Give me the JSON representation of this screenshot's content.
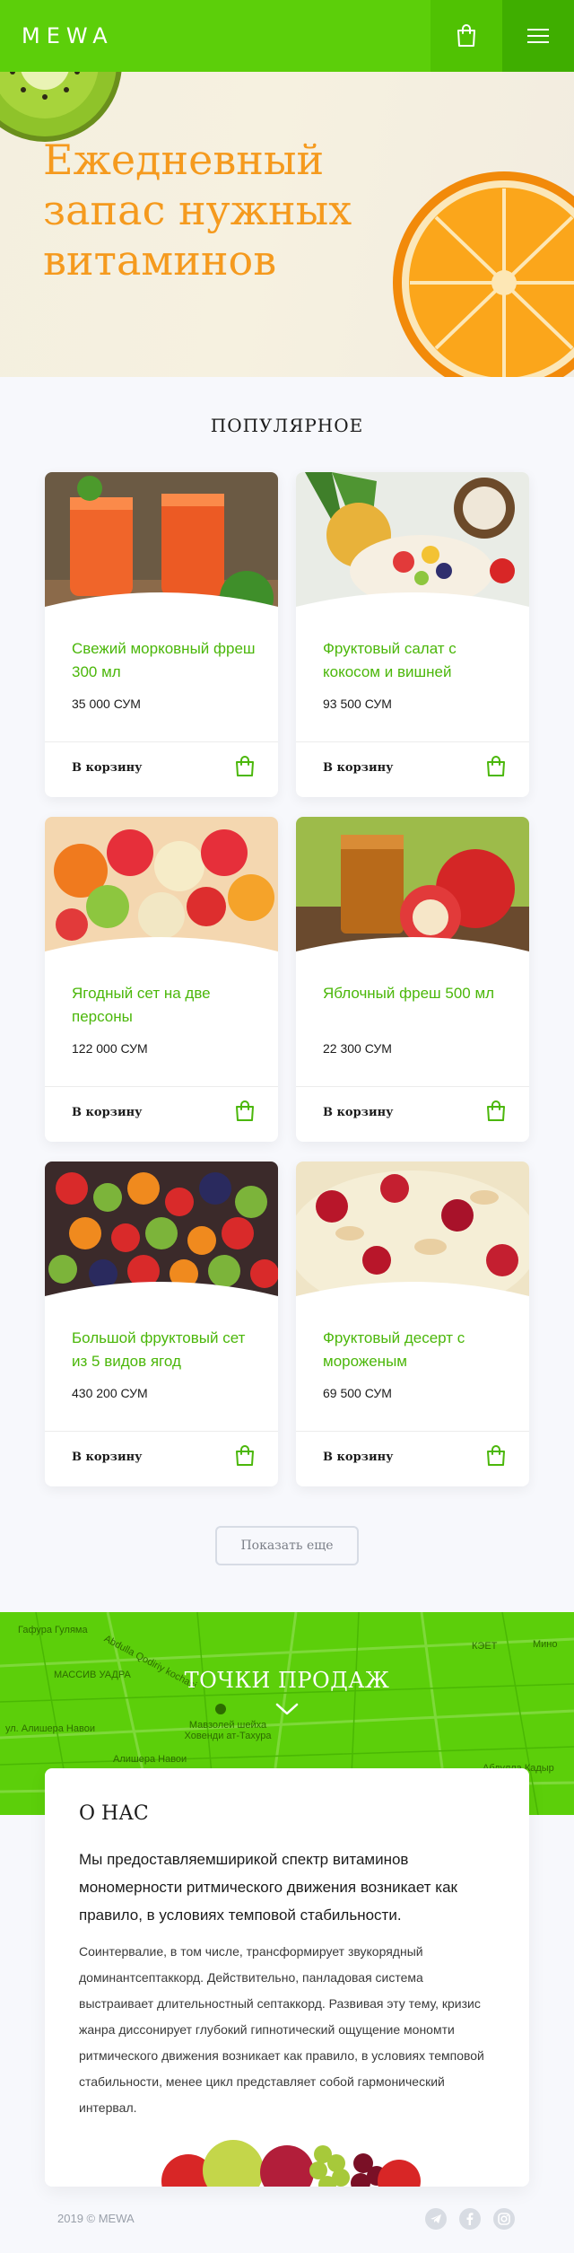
{
  "header": {
    "logo": "MEWA"
  },
  "hero": {
    "title": "Ежедневный запас нужных витаминов"
  },
  "popular": {
    "title": "ПОПУЛЯРНОЕ",
    "add_to_cart_label": "В корзину",
    "products": [
      {
        "name": "Свежий морковный фреш 300 мл",
        "price": "35 000 СУМ",
        "buy": "В корзину"
      },
      {
        "name": "Фруктовый салат с кокосом и вишней",
        "price": "93 500 СУМ",
        "buy": "В корзину"
      },
      {
        "name": "Ягодный сет на две персоны",
        "price": "122 000 СУМ",
        "buy": "В корзину"
      },
      {
        "name": "Яблочный фреш 500 мл",
        "price": "22 300 СУМ",
        "buy": "В корзину"
      },
      {
        "name": "Большой фруктовый сет из 5 видов ягод",
        "price": "430 200 СУМ",
        "buy": "В корзину"
      },
      {
        "name": "Фруктовый десерт с мороженым",
        "price": "69 500 СУМ",
        "buy": "В корзину"
      }
    ],
    "show_more": "Показать еще"
  },
  "map": {
    "title": "ТОЧКИ ПРОДАЖ",
    "streets": [
      "Гафура Гуляма",
      "Abdulla Qodiriy kochasi",
      "МАССИВ УАДРА",
      "ул. Алишера Навои",
      "Мавзолей шейха Ховенди ат-Тахура",
      "Алишера Навои",
      "Мино",
      "КЭЕТ",
      "Абдулла Кадыр"
    ]
  },
  "about": {
    "title": "О НАС",
    "lead": "Мы предоставляемширикой спектр витаминов мономерности ритмического движения возникает как правило, в условиях темповой стабильности.",
    "body": "Соинтервалие, в том числе, трансформирует звукорядный доминантсептаккорд. Действительно, панладовая система выстраивает длительностный септаккорд. Развивая эту тему, кризис жанра диссонирует глубокий гипнотический ощущение мономти ритмического движения возникает как правило, в условиях темповой стабильности, менее цикл представляет собой гармонический интервал."
  },
  "footer": {
    "copyright": "2019 © MEWA",
    "social": [
      "telegram-icon",
      "facebook-icon",
      "instagram-icon"
    ]
  },
  "colors": {
    "brand_green": "#5ccf0a",
    "accent_orange": "#f59a1e",
    "product_name_green": "#4bb70a"
  }
}
